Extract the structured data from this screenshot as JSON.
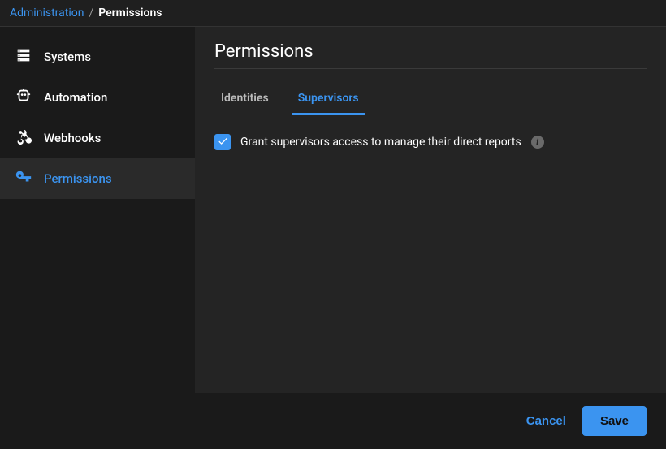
{
  "breadcrumb": {
    "parent": "Administration",
    "separator": "/",
    "current": "Permissions"
  },
  "sidebar": {
    "items": [
      {
        "label": "Systems"
      },
      {
        "label": "Automation"
      },
      {
        "label": "Webhooks"
      },
      {
        "label": "Permissions"
      }
    ]
  },
  "page": {
    "title": "Permissions"
  },
  "tabs": [
    {
      "label": "Identities"
    },
    {
      "label": "Supervisors"
    }
  ],
  "permission": {
    "grant_label": "Grant supervisors access to manage their direct reports",
    "info_char": "i"
  },
  "footer": {
    "cancel": "Cancel",
    "save": "Save"
  }
}
